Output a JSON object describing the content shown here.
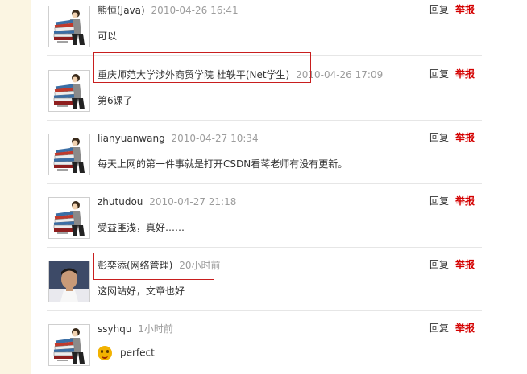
{
  "colors": {
    "report": "#d40000",
    "highlight_border": "#c81e1e",
    "time": "#9c9c9c",
    "gutter": "#fbf5e2"
  },
  "actions": {
    "reply": "回复",
    "report": "举报"
  },
  "comments": [
    {
      "author": "熊恒(Java)",
      "time": "2010-04-26 16:41",
      "text": "可以",
      "avatar": "books-cartoon-icon"
    },
    {
      "author": "重庆师范大学涉外商贸学院 杜轶平(Net学生)",
      "time": "2010-04-26 17:09",
      "text": "第6课了",
      "avatar": "books-cartoon-icon",
      "highlighted": true
    },
    {
      "author": "lianyuanwang",
      "time": "2010-04-27 10:34",
      "text": "每天上网的第一件事就是打开CSDN看蒋老师有没有更新。",
      "avatar": "books-cartoon-icon"
    },
    {
      "author": "zhutudou",
      "time": "2010-04-27 21:18",
      "text": "受益匪浅，真好……",
      "avatar": "books-cartoon-icon"
    },
    {
      "author": "彭奕添(网络管理)",
      "time": "20小时前",
      "text": "这网站好，文章也好",
      "avatar": "user-photo",
      "highlighted": true
    },
    {
      "author": "ssyhqu",
      "time": "1小时前",
      "text": "perfect",
      "avatar": "books-cartoon-icon",
      "emoji": "smiley-emoji-icon"
    }
  ]
}
